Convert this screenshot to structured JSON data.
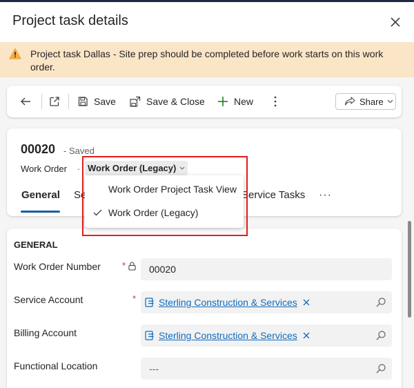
{
  "panel": {
    "title": "Project task details"
  },
  "warning": {
    "text": "Project task Dallas - Site prep should be completed before work starts on this work order."
  },
  "commands": {
    "save": "Save",
    "save_close": "Save & Close",
    "new": "New",
    "share": "Share"
  },
  "record": {
    "id": "00020",
    "saved_status": "- Saved",
    "entity": "Work Order",
    "separator": "·",
    "form_name": "Work Order (Legacy)"
  },
  "tabs": [
    {
      "label": "General"
    },
    {
      "label": "Se"
    },
    {
      "label": "Service Tasks"
    }
  ],
  "form_menu": {
    "items": [
      {
        "label": "Work Order Project Task View",
        "selected": false
      },
      {
        "label": "Work Order (Legacy)",
        "selected": true
      }
    ]
  },
  "section": {
    "title": "GENERAL",
    "fields": [
      {
        "label": "Work Order Number",
        "value": "00020",
        "required": "*"
      },
      {
        "label": "Service Account",
        "value": "Sterling Construction & Services",
        "required": "*"
      },
      {
        "label": "Billing Account",
        "value": "Sterling Construction & Services"
      },
      {
        "label": "Functional Location",
        "value": "---"
      }
    ]
  },
  "icons": [
    "close-icon",
    "warning-icon",
    "back-icon",
    "open-new-window-icon",
    "save-icon",
    "save-close-icon",
    "add-icon",
    "more-vertical-icon",
    "share-icon",
    "chevron-down-icon",
    "check-icon",
    "lock-icon",
    "entity-icon",
    "remove-icon",
    "search-icon"
  ],
  "colors": {
    "warning_bg": "#fbe5c7",
    "accent": "#115ea3",
    "link": "#0f6cbd",
    "required": "#c4314b",
    "highlight": "#e21b1b"
  }
}
